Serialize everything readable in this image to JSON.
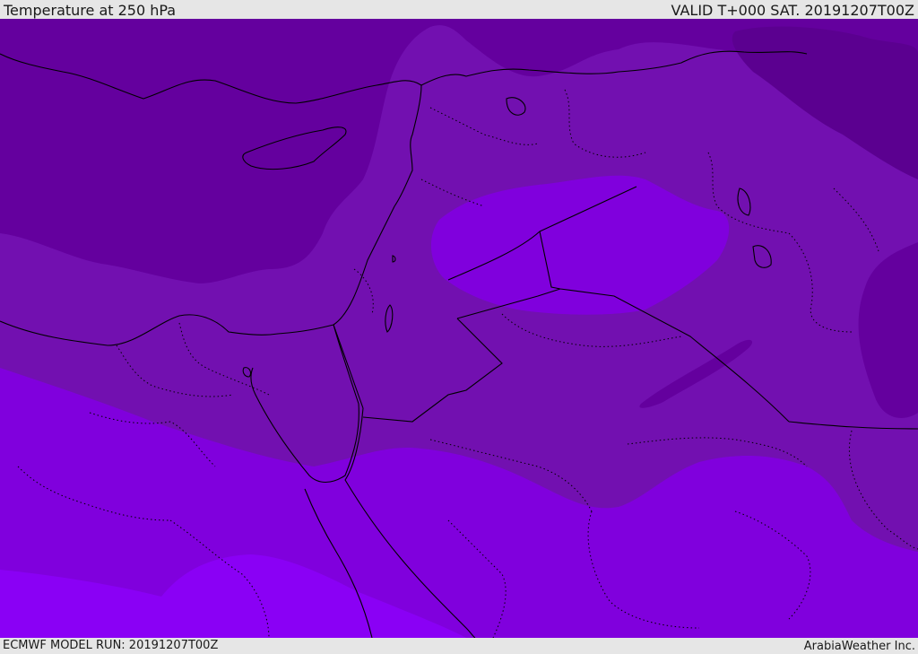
{
  "header": {
    "title": "Temperature at 250 hPa",
    "valid": "VALID T+000 SAT. 20191207T00Z"
  },
  "footer": {
    "model_run": "ECMWF MODEL RUN: 20191207T00Z",
    "credit": "ArabiaWeather Inc."
  },
  "colors": {
    "darkest": "#5b0090",
    "dark": "#64009e",
    "mid": "#7210b0",
    "bright": "#8000dd",
    "brightest": "#8a00f5",
    "boundary": "#000000"
  }
}
